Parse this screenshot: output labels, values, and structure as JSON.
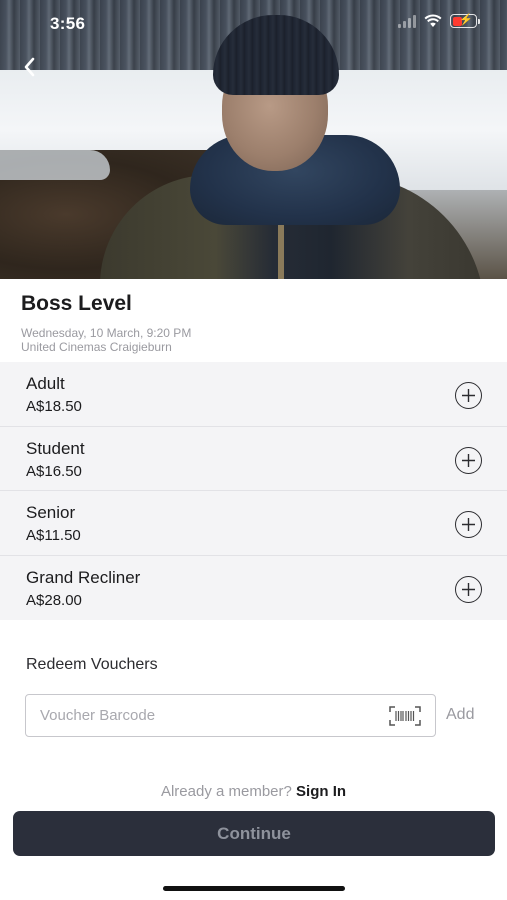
{
  "status_bar": {
    "time": "3:56"
  },
  "movie": {
    "title": "Boss Level",
    "session_datetime": "Wednesday, 10 March, 9:20 PM",
    "cinema": "United Cinemas Craigieburn"
  },
  "tickets": [
    {
      "name": "Adult",
      "price": "A$18.50"
    },
    {
      "name": "Student",
      "price": "A$16.50"
    },
    {
      "name": "Senior",
      "price": "A$11.50"
    },
    {
      "name": "Grand Recliner",
      "price": "A$28.00"
    }
  ],
  "vouchers": {
    "label": "Redeem Vouchers",
    "placeholder": "Voucher Barcode",
    "value": "",
    "add_label": "Add"
  },
  "member": {
    "prompt": "Already a member?",
    "sign_in": "Sign In"
  },
  "continue_label": "Continue",
  "icons": {
    "back": "chevron-left-icon",
    "plus": "plus-circle-icon",
    "barcode": "barcode-scan-icon",
    "wifi": "wifi-icon",
    "battery": "battery-charging-icon"
  },
  "colors": {
    "continue_bg": "#2b2f3b",
    "ticket_bg": "#f4f4f6",
    "battery_low": "#ff3b30"
  }
}
